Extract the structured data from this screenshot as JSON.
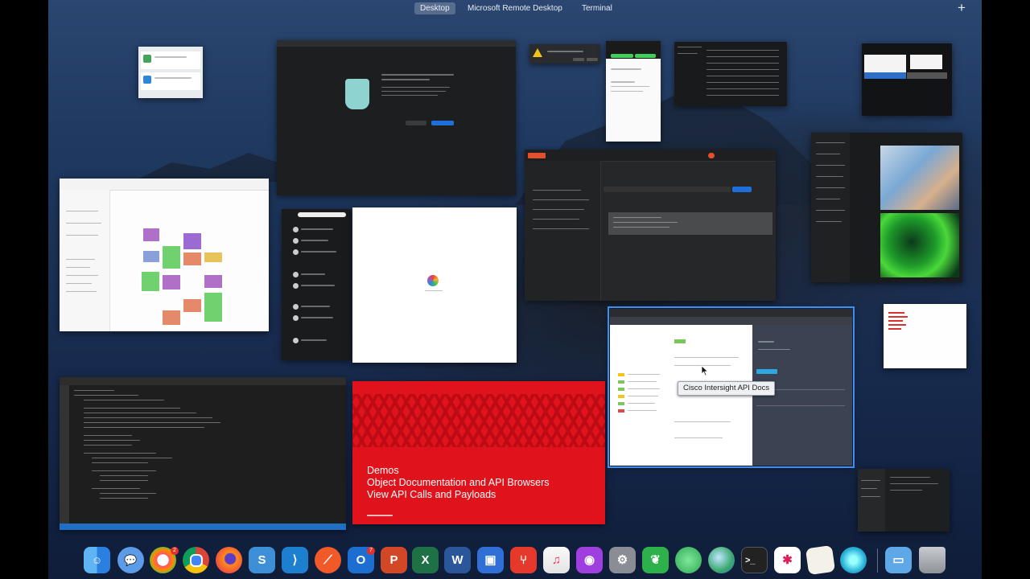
{
  "spaces": {
    "items": [
      "Desktop",
      "Microsoft Remote Desktop",
      "Terminal"
    ],
    "active": "Desktop",
    "add_icon": "plus-icon"
  },
  "slide": {
    "line1": "Demos",
    "line2": "Object Documentation and API Browsers",
    "line3": "View API Calls and Payloads"
  },
  "tooltip": {
    "text": "Cisco Intersight API Docs"
  },
  "colors": {
    "slide_red": "#e0121b",
    "selection_blue": "#3f8ff0",
    "accent_blue": "#1e6fd9"
  },
  "dock": {
    "apps": [
      "finder-icon",
      "messages-icon",
      "photo-booth-icon",
      "chrome-icon",
      "firefox-icon",
      "scrivener-icon",
      "vscode-icon",
      "safari-icon",
      "outlook-icon",
      "powerpoint-icon",
      "excel-icon",
      "word-icon",
      "remote-desktop-icon",
      "git-icon",
      "music-icon",
      "podcasts-icon",
      "system-preferences-icon",
      "evernote-icon",
      "webex-teams-icon",
      "maps-icon",
      "terminal-icon",
      "slack-icon",
      "notes-icon",
      "jabber-icon",
      "downloads-folder-icon",
      "trash-icon"
    ],
    "outlook_badge": "7"
  }
}
